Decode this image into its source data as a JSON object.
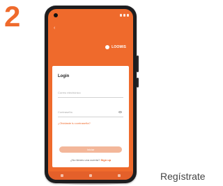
{
  "step": {
    "number": "2"
  },
  "phone": {
    "brand": {
      "name": "LOOMIS"
    },
    "login": {
      "title": "Login",
      "email_placeholder": "Correo electrónico",
      "password_placeholder": "Contraseña",
      "forgot_link": "¿Olvidaste tu contraseña?",
      "submit_label": "Iniciar",
      "signup_prompt": "¿No tienes una cuenta?",
      "signup_link": "Sign up"
    }
  },
  "caption": {
    "text": "Regístrate"
  },
  "colors": {
    "accent": "#ef6a2c",
    "button_disabled": "#f3b79a"
  }
}
